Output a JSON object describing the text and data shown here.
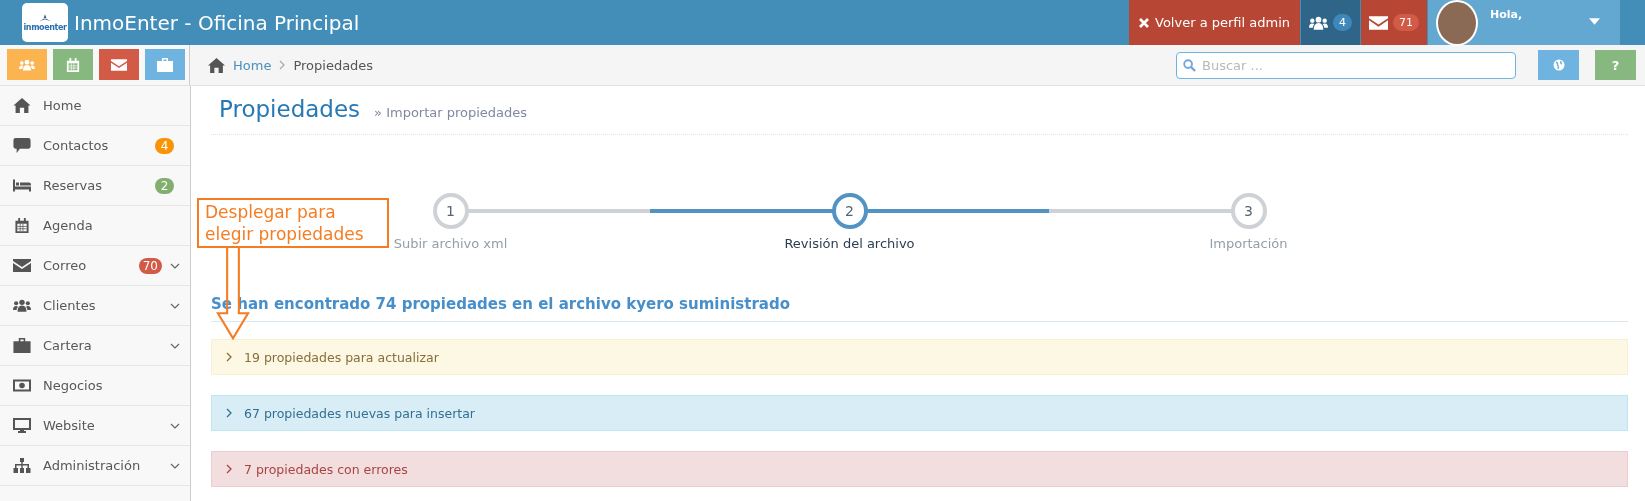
{
  "header": {
    "logo_text": "inmoenter",
    "title": "InmoEnter - Oficina Principal",
    "admin_button": "Volver a perfil admin",
    "users_badge": "4",
    "mail_badge": "71",
    "greeting": "Hola,"
  },
  "quick_buttons": [
    {
      "kind": "users",
      "color": "#fbb450"
    },
    {
      "kind": "calendar",
      "color": "#87b87f"
    },
    {
      "kind": "mail",
      "color": "#d15b47"
    },
    {
      "kind": "briefcase",
      "color": "#6fb3e0"
    }
  ],
  "breadcrumb": [
    "Home",
    "Propiedades"
  ],
  "search": {
    "placeholder": "Buscar ..."
  },
  "help_button": "?",
  "sidebar": {
    "items": [
      {
        "label": "Home",
        "submenu": false
      },
      {
        "label": "Contactos",
        "badge": "4",
        "color": "#f89406",
        "submenu": false
      },
      {
        "label": "Reservas",
        "badge": "2",
        "color": "#82af6f",
        "submenu": false
      },
      {
        "label": "Agenda",
        "submenu": false
      },
      {
        "label": "Correo",
        "badge": "70",
        "color": "#d15b47",
        "submenu": true
      },
      {
        "label": "Clientes",
        "submenu": true
      },
      {
        "label": "Cartera",
        "submenu": true
      },
      {
        "label": "Negocios",
        "submenu": false
      },
      {
        "label": "Website",
        "submenu": true
      },
      {
        "label": "Administración",
        "submenu": true
      }
    ]
  },
  "page": {
    "title": "Propiedades",
    "subtitle": "» Importar propiedades"
  },
  "steps": [
    {
      "number": "1",
      "label": "Subir archivo xml",
      "selected": false
    },
    {
      "number": "2",
      "label": "Revisión del archivo",
      "selected": true
    },
    {
      "number": "3",
      "label": "Importación",
      "selected": false
    }
  ],
  "summary": "Se han encontrado 74 propiedades en el archivo kyero suministrado",
  "panels": [
    {
      "kind": "warning",
      "label": "19 propiedades para actualizar",
      "expanded": false
    },
    {
      "kind": "info",
      "label": "67 propiedades nuevas para insertar",
      "expanded": false
    },
    {
      "kind": "danger",
      "label": "7 propiedades con errores",
      "expanded": false
    }
  ],
  "annotation": {
    "text": "Desplegar para elegir propiedades"
  }
}
